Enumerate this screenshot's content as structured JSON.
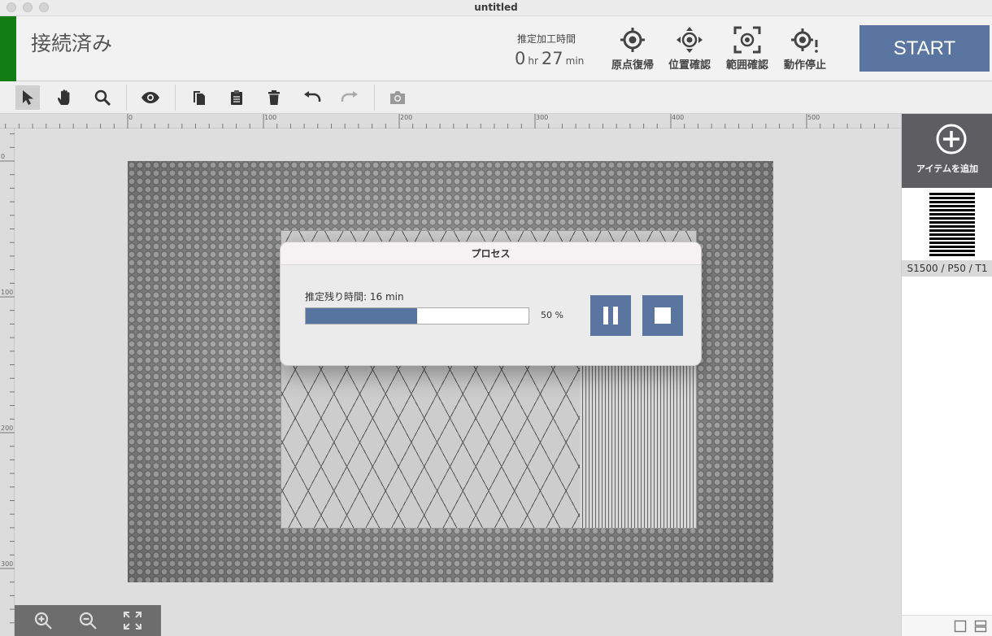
{
  "window": {
    "title": "untitled"
  },
  "header": {
    "status": "接続済み",
    "status_color": "#127d12",
    "estimate_label": "推定加工時間",
    "estimate_hours": "0",
    "estimate_hr_unit": "hr",
    "estimate_minutes": "27",
    "estimate_min_unit": "min",
    "buttons": [
      {
        "label": "原点復帰",
        "icon": "home-target-icon"
      },
      {
        "label": "位置確認",
        "icon": "move-target-icon"
      },
      {
        "label": "範囲確認",
        "icon": "frame-target-icon"
      },
      {
        "label": "動作停止",
        "icon": "stop-target-icon"
      }
    ],
    "start_label": "START",
    "accent_color": "#5975a0"
  },
  "toolbar": {
    "tools": [
      "select-icon",
      "hand-icon",
      "zoom-icon",
      "eye-icon",
      "copy-icon",
      "paste-icon",
      "trash-icon",
      "undo-icon",
      "redo-icon",
      "camera-icon"
    ]
  },
  "rulers": {
    "top": [
      "0",
      "100",
      "200",
      "300",
      "400",
      "500"
    ],
    "left": [
      "0",
      "100",
      "200",
      "300"
    ]
  },
  "sidebar": {
    "add_label": "アイテムを追加",
    "item_caption": "S1500 / P50 / T1"
  },
  "dialog": {
    "title": "プロセス",
    "remaining": "推定残り時間: 16 min",
    "progress": 0.5,
    "progress_text": "50 %"
  }
}
